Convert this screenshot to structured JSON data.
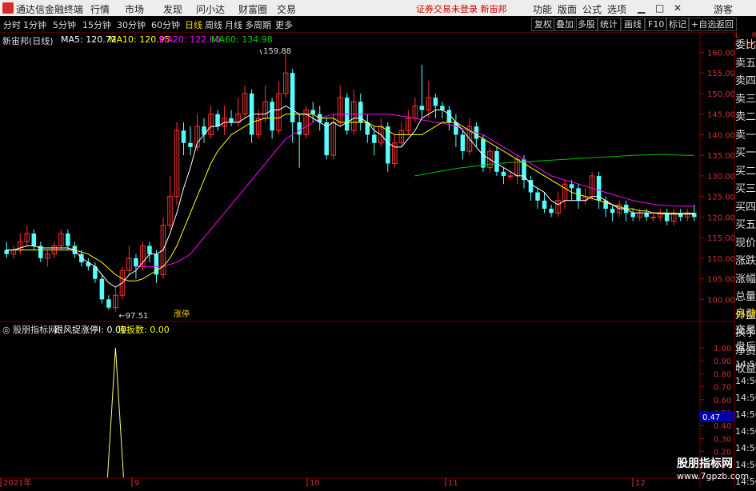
{
  "window": {
    "app_title": "通达信金融终端",
    "menu": [
      "行情",
      "市场",
      "发现",
      "问小达",
      "财富圈",
      "交易"
    ],
    "notice": "证券交易未登录  新宙邦",
    "right_menu": [
      "功能",
      "版面",
      "公式",
      "选项"
    ],
    "guest": "游客",
    "controls": [
      "▁",
      "□",
      "✕"
    ]
  },
  "toolbar": {
    "periods": [
      "分时",
      "1分钟",
      "5分钟",
      "15分钟",
      "30分钟",
      "60分钟",
      "日线",
      "周线",
      "月线",
      "多周期",
      "更多"
    ],
    "active_period": "日线",
    "buttons": [
      "复权",
      "叠加",
      "多股",
      "统计",
      "画线",
      "F10",
      "标记",
      "+自选",
      "返回"
    ]
  },
  "chart_header": {
    "stock": "新宙邦(日线)",
    "ma5": "MA5: 120.72",
    "ma10": "MA10: 120.95",
    "ma20": "MA20: 122.60",
    "ma60": "MA60: 134.98",
    "colors": {
      "ma5": "#ffffff",
      "ma10": "#ffff00",
      "ma20": "#ff00ff",
      "ma60": "#00c000",
      "up": "#ff3030",
      "down": "#54ffff"
    }
  },
  "indicator_header": {
    "name": "股朋指标网",
    "label1": "跟风捉涨停I: 0.00",
    "label2": "连扳数: 0.00"
  },
  "chart_data": {
    "type": "candlestick",
    "price_axis": {
      "min": 96,
      "max": 163,
      "ticks": [
        160,
        155,
        150,
        145,
        140,
        135,
        130,
        125,
        120,
        115,
        110,
        105,
        100
      ],
      "labels": [
        "160.00",
        "155.00",
        "150.00",
        "145.00",
        "140.00",
        "135.00",
        "130.00",
        "125.00",
        "120.00",
        "115.00",
        "110.00",
        "105.00",
        "100.00"
      ]
    },
    "annotations": {
      "high": "159.88",
      "low": "97.51",
      "limit_up": "涨停"
    },
    "date_labels": [
      "2021年",
      "9",
      "10",
      "11",
      "12"
    ],
    "indicator_axis": {
      "min": 0,
      "max": 1.08,
      "labels": [
        "1.00",
        "0.90",
        "0.80",
        "0.70",
        "0.60",
        "0.50",
        "0.40",
        "0.30",
        "0.20",
        "0.10"
      ]
    },
    "indicator_marker": "0.47",
    "indicator_spike_index": 16,
    "indicator_spike_value": 1.0,
    "candles": [
      [
        112,
        111,
        114,
        110
      ],
      [
        111,
        112,
        113,
        110
      ],
      [
        112,
        114,
        116,
        111
      ],
      [
        114,
        116,
        118,
        113
      ],
      [
        116,
        113,
        117,
        112
      ],
      [
        113,
        110,
        114,
        109
      ],
      [
        110,
        111,
        112,
        108
      ],
      [
        111,
        113,
        114,
        110
      ],
      [
        113,
        116,
        117,
        112
      ],
      [
        116,
        113,
        117,
        112
      ],
      [
        113,
        111,
        114,
        110
      ],
      [
        111,
        109,
        112,
        108
      ],
      [
        109,
        108,
        110,
        107
      ],
      [
        108,
        105,
        109,
        104
      ],
      [
        105,
        100,
        106,
        99
      ],
      [
        100,
        98,
        101,
        97.5
      ],
      [
        98,
        101,
        103,
        97
      ],
      [
        101,
        107,
        108,
        100
      ],
      [
        107,
        110,
        113,
        106
      ],
      [
        110,
        108,
        111,
        105
      ],
      [
        108,
        113,
        114,
        107
      ],
      [
        113,
        111,
        114,
        109
      ],
      [
        111,
        106,
        112,
        104
      ],
      [
        106,
        118,
        120,
        105
      ],
      [
        118,
        125,
        130,
        117
      ],
      [
        125,
        141,
        143,
        123
      ],
      [
        141,
        138,
        143,
        135
      ],
      [
        138,
        137,
        142,
        135
      ],
      [
        137,
        142,
        145,
        136
      ],
      [
        142,
        140,
        144,
        138
      ],
      [
        140,
        145,
        147,
        139
      ],
      [
        145,
        142,
        146,
        141
      ],
      [
        142,
        144,
        147,
        140
      ],
      [
        144,
        143,
        146,
        142
      ],
      [
        143,
        145,
        149,
        142
      ],
      [
        145,
        150,
        152,
        144
      ],
      [
        150,
        140,
        151,
        138
      ],
      [
        140,
        144,
        146,
        139
      ],
      [
        144,
        148,
        152,
        143
      ],
      [
        148,
        141,
        149,
        139
      ],
      [
        141,
        150,
        153,
        140
      ],
      [
        150,
        155,
        159.88,
        149
      ],
      [
        155,
        143,
        156,
        138
      ],
      [
        143,
        140,
        145,
        132
      ],
      [
        140,
        146,
        147,
        139
      ],
      [
        146,
        145,
        148,
        143
      ],
      [
        145,
        143,
        147,
        141
      ],
      [
        143,
        135,
        144,
        134
      ],
      [
        135,
        143,
        145,
        134
      ],
      [
        143,
        149,
        152,
        142
      ],
      [
        149,
        141,
        150,
        140
      ],
      [
        141,
        148,
        151,
        140
      ],
      [
        148,
        143,
        150,
        141
      ],
      [
        143,
        140,
        145,
        138
      ],
      [
        140,
        138,
        142,
        135
      ],
      [
        138,
        142,
        144,
        137
      ],
      [
        142,
        133,
        143,
        131
      ],
      [
        133,
        138,
        140,
        132
      ],
      [
        138,
        141,
        143,
        137
      ],
      [
        141,
        144,
        146,
        140
      ],
      [
        144,
        147,
        149,
        143
      ],
      [
        147,
        146,
        157,
        144
      ],
      [
        146,
        149,
        153,
        144
      ],
      [
        149,
        147,
        150,
        144
      ],
      [
        147,
        146,
        148,
        144
      ],
      [
        146,
        143,
        147,
        141
      ],
      [
        143,
        140,
        145,
        137
      ],
      [
        140,
        136,
        141,
        134
      ],
      [
        136,
        142,
        144,
        135
      ],
      [
        142,
        139,
        143,
        137
      ],
      [
        139,
        132,
        140,
        131
      ],
      [
        132,
        136,
        137,
        131
      ],
      [
        136,
        131,
        137,
        130
      ],
      [
        131,
        130,
        132,
        128
      ],
      [
        130,
        130,
        131,
        129
      ],
      [
        130,
        134,
        135,
        128
      ],
      [
        134,
        129,
        135,
        127
      ],
      [
        129,
        126,
        130,
        124
      ],
      [
        126,
        124,
        127,
        122
      ],
      [
        124,
        122,
        126,
        121
      ],
      [
        122,
        121,
        123,
        120
      ],
      [
        121,
        124,
        126,
        120
      ],
      [
        124,
        128,
        129,
        122
      ],
      [
        128,
        127,
        129,
        124
      ],
      [
        127,
        124,
        128,
        122
      ],
      [
        124,
        125,
        127,
        123
      ],
      [
        125,
        130,
        131,
        124
      ],
      [
        130,
        124,
        131,
        122
      ],
      [
        124,
        122,
        125,
        120
      ],
      [
        122,
        121,
        123,
        119
      ],
      [
        121,
        123,
        124,
        120
      ],
      [
        123,
        121,
        124,
        119
      ],
      [
        121,
        120,
        122,
        119
      ],
      [
        120,
        121,
        122,
        119
      ],
      [
        121,
        120,
        122,
        119
      ],
      [
        120,
        120,
        121,
        119
      ],
      [
        120,
        121,
        122,
        119
      ],
      [
        121,
        119,
        122,
        118
      ],
      [
        119,
        121,
        122,
        118
      ],
      [
        121,
        120,
        122,
        119
      ],
      [
        120,
        121,
        122,
        119
      ],
      [
        121,
        120,
        123,
        119
      ]
    ],
    "ma5": [
      112,
      112,
      112.5,
      113,
      113,
      112.5,
      112.5,
      112.5,
      112.5,
      112.5,
      112,
      110,
      109,
      108,
      106,
      104,
      103,
      104,
      106,
      107,
      109,
      111,
      111,
      112,
      116,
      121,
      127,
      132,
      138,
      140,
      142,
      142,
      143,
      143,
      143,
      144,
      145,
      145,
      145,
      146,
      146,
      147,
      146,
      145,
      145,
      144,
      143,
      142,
      143,
      142,
      143,
      144,
      144,
      143,
      141,
      140,
      138,
      137,
      137,
      139,
      141,
      144,
      145,
      146,
      146,
      145,
      143,
      141,
      139,
      137,
      135,
      134,
      133,
      132,
      131,
      130,
      130,
      128,
      127,
      126,
      124,
      123,
      124,
      124,
      124,
      124,
      125,
      125,
      124,
      123,
      122,
      122,
      121,
      121,
      121,
      121,
      120.8,
      120.7,
      120.7,
      120.7,
      120.7,
      120.72
    ],
    "ma10": [
      112,
      112,
      112,
      112,
      112,
      112,
      112,
      112,
      112,
      112,
      112,
      111.5,
      111,
      110,
      109,
      107.5,
      106,
      105,
      104.5,
      104.5,
      105,
      106,
      107,
      108,
      110,
      113,
      117,
      121,
      125,
      129,
      133,
      136,
      138,
      140,
      141,
      142,
      143,
      143.5,
      144,
      144,
      144,
      145,
      145,
      145,
      145,
      145,
      144,
      144,
      144,
      143,
      143,
      143,
      143,
      143,
      142,
      142,
      141,
      140,
      140,
      140,
      140,
      140,
      141,
      142,
      143,
      143,
      143,
      142,
      141,
      140,
      139,
      138,
      137,
      136,
      135,
      134,
      133,
      132,
      131,
      130,
      129,
      128,
      127,
      126,
      125.5,
      125,
      124.5,
      124,
      123.5,
      123,
      122.5,
      122,
      122,
      121.5,
      121.5,
      121,
      121,
      121,
      120.9,
      120.9,
      120.95,
      120.95
    ],
    "ma20": [
      null,
      null,
      null,
      null,
      null,
      null,
      null,
      null,
      null,
      null,
      null,
      null,
      null,
      null,
      null,
      null,
      null,
      null,
      null,
      108,
      108,
      108,
      108,
      108,
      108.5,
      109,
      110,
      111,
      113,
      115,
      117,
      119,
      121,
      123,
      125,
      127,
      129,
      131,
      133,
      135,
      137,
      139,
      140,
      141,
      142,
      143,
      144,
      144.5,
      145,
      145,
      145,
      145,
      145,
      145,
      145,
      145,
      145,
      144.8,
      144.5,
      144.3,
      144,
      143.6,
      143.3,
      143,
      142.8,
      142.5,
      142,
      141.5,
      141,
      140.5,
      140,
      139,
      138,
      137,
      136,
      135,
      134,
      133,
      132,
      131,
      130,
      129.5,
      129,
      128.5,
      128,
      127.5,
      127,
      126.5,
      126,
      125.5,
      125,
      124.5,
      124,
      123.7,
      123.4,
      123.1,
      122.9,
      122.8,
      122.7,
      122.65,
      122.6,
      122.6
    ],
    "ma60": [
      null,
      null,
      null,
      null,
      null,
      null,
      null,
      null,
      null,
      null,
      null,
      null,
      null,
      null,
      null,
      null,
      null,
      null,
      null,
      null,
      null,
      null,
      null,
      null,
      null,
      null,
      null,
      null,
      null,
      null,
      null,
      null,
      null,
      null,
      null,
      null,
      null,
      null,
      null,
      null,
      null,
      null,
      null,
      null,
      null,
      null,
      null,
      null,
      null,
      null,
      null,
      null,
      null,
      null,
      null,
      null,
      null,
      null,
      null,
      null,
      130,
      130.3,
      130.6,
      130.9,
      131.2,
      131.5,
      131.8,
      132,
      132.2,
      132.4,
      132.6,
      132.8,
      133,
      133.1,
      133.2,
      133.3,
      133.4,
      133.5,
      133.6,
      133.7,
      133.8,
      133.9,
      134,
      134.1,
      134.2,
      134.3,
      134.4,
      134.5,
      134.6,
      134.7,
      134.8,
      134.9,
      135,
      135.05,
      135.1,
      135.15,
      135.2,
      135.2,
      135.1,
      135.05,
      135,
      134.98
    ]
  },
  "sidebar": [
    "委比",
    "卖五",
    "卖四",
    "卖三",
    "卖二",
    "卖一",
    "买一",
    "买二",
    "买三",
    "买四",
    "买五",
    "现价",
    "涨跌",
    "涨幅",
    "总量",
    "外盘",
    "换手",
    "净资",
    "收益"
  ],
  "sidebar_bottom": [
    "自动",
    "交易",
    "盘后",
    "14:56",
    "14:56",
    "14:56",
    "14:56",
    "14:56",
    "14:56",
    "14:56",
    "14:56"
  ],
  "sidebar_top_label": "L",
  "sidebar_top_label2": "R",
  "sidebar_top_num": "500",
  "watermark": {
    "line1": "股朋指标网",
    "line2": "www.7gpzb.com"
  }
}
